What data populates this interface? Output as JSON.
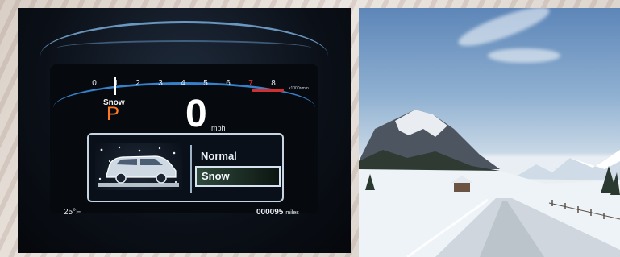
{
  "cluster": {
    "tach_ticks": [
      "0",
      "1",
      "2",
      "3",
      "4",
      "5",
      "6",
      "7",
      "8"
    ],
    "tach_unit": "x1000r/min",
    "drive_mode_indicator": "Snow",
    "gear": "P",
    "speed": "0",
    "speed_unit": "mph",
    "menu_options": [
      "Normal",
      "Snow"
    ],
    "selected_option": "Snow",
    "temperature": "25°F",
    "odometer": "000095",
    "odometer_unit": "miles"
  },
  "colors": {
    "gear": "#ff7a24",
    "accent_blue": "#3b8fe0",
    "redline": "#d03030"
  }
}
